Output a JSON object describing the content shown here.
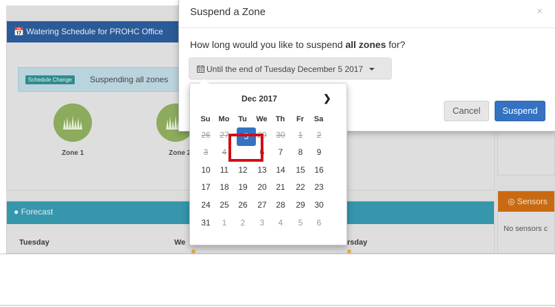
{
  "schedule": {
    "title": "Watering Schedule for PROHC Office",
    "badge": "Schedule Change",
    "alert_text": "Suspending all zones",
    "zones": [
      {
        "label": "Zone 1"
      },
      {
        "label": "Zone 2"
      }
    ]
  },
  "forecast": {
    "title": "Forecast",
    "days": [
      "Tuesday",
      "We",
      "rsday"
    ]
  },
  "sensors": {
    "title": "Sensors",
    "empty_text": "No sensors c"
  },
  "modal": {
    "title": "Suspend a Zone",
    "close_glyph": "×",
    "question_pre": "How long would you like to suspend ",
    "question_bold": "all zones",
    "question_post": " for?",
    "dropdown_value": "Until the end of Tuesday December 5 2017",
    "cancel_label": "Cancel",
    "suspend_label": "Suspend"
  },
  "datepicker": {
    "month_label": "Dec 2017",
    "next_glyph": "❯",
    "weekdays": [
      "Su",
      "Mo",
      "Tu",
      "We",
      "Th",
      "Fr",
      "Sa"
    ],
    "weeks": [
      [
        "26",
        "27",
        "28",
        "29",
        "30",
        "1",
        "2"
      ],
      [
        "3",
        "4",
        "5",
        "6",
        "7",
        "8",
        "9"
      ],
      [
        "10",
        "11",
        "12",
        "13",
        "14",
        "15",
        "16"
      ],
      [
        "17",
        "18",
        "19",
        "20",
        "21",
        "22",
        "23"
      ],
      [
        "24",
        "25",
        "26",
        "27",
        "28",
        "29",
        "30"
      ],
      [
        "31",
        "1",
        "2",
        "3",
        "4",
        "5",
        "6"
      ]
    ],
    "selected_day": "5",
    "disabled_days": [
      "26",
      "27",
      "28",
      "29",
      "30",
      "1",
      "2",
      "3",
      "4"
    ]
  },
  "colors": {
    "primary": "#3572c2",
    "highlight": "#d10f15",
    "schedule_header": "#2b5a98",
    "forecast_header": "#3596ac",
    "sensors_header": "#c96a12",
    "zone_green": "#8cab5c"
  },
  "icons": [
    "calendar-icon",
    "sun-icon",
    "sensor-icon",
    "close-icon",
    "chevron-right-icon",
    "caret-down-icon"
  ]
}
